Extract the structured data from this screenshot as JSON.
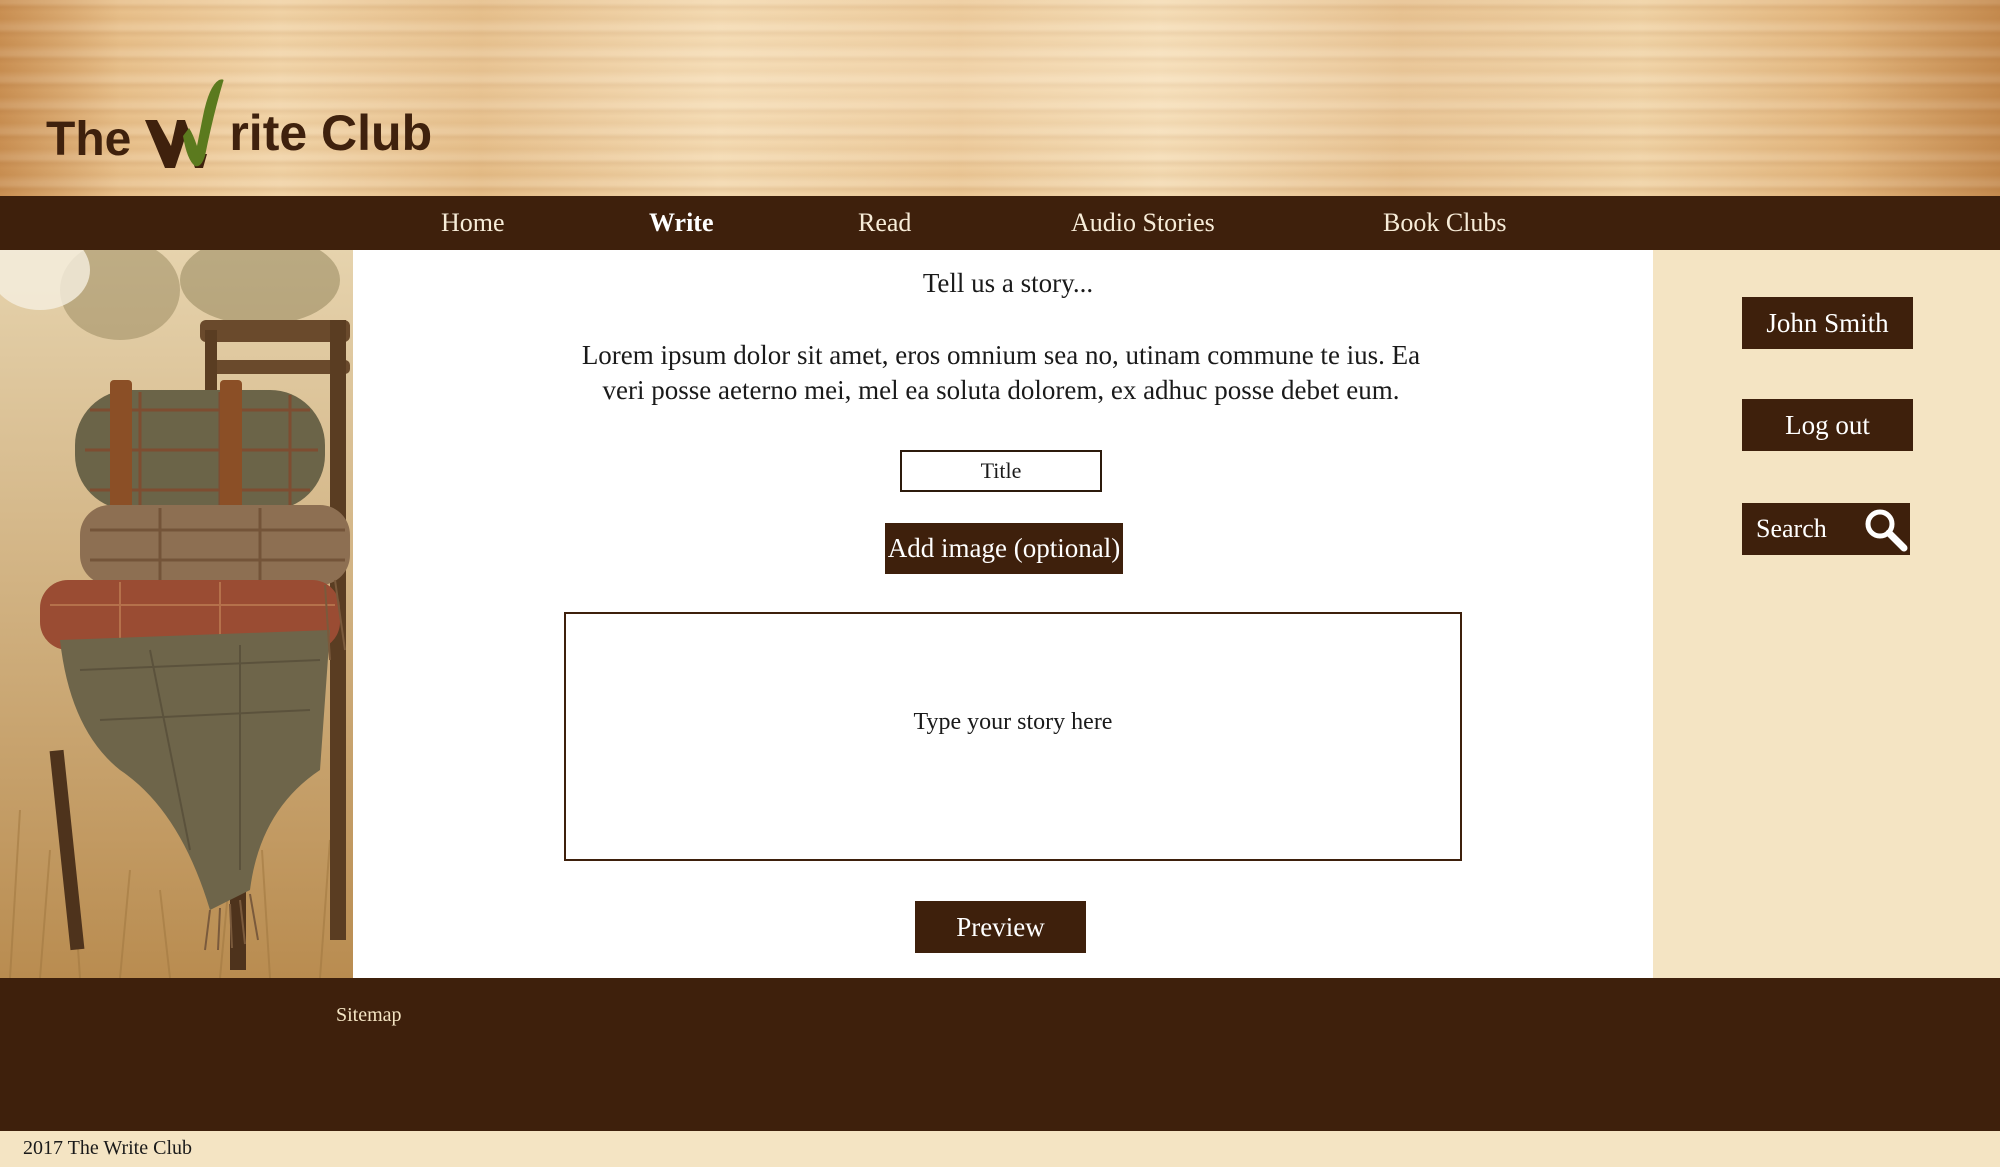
{
  "brand": {
    "logo_prefix": "The",
    "logo_suffix": "rite Club",
    "logo_text": "The Write Club",
    "logo_color": "#3f210d",
    "check_color": "#5b7a1e"
  },
  "nav": {
    "items": [
      {
        "label": "Home",
        "active": false
      },
      {
        "label": "Write",
        "active": true
      },
      {
        "label": "Read",
        "active": false
      },
      {
        "label": "Audio Stories",
        "active": false
      },
      {
        "label": "Book Clubs",
        "active": false
      }
    ]
  },
  "main": {
    "heading": "Tell us a story...",
    "intro": "Lorem ipsum dolor sit amet, eros omnium sea no, utinam commune te ius. Ea veri posse aeterno mei, mel ea soluta dolorem, ex adhuc posse debet eum.",
    "title_placeholder": "Title",
    "add_image_label": "Add image (optional)",
    "story_placeholder": "Type your story here",
    "preview_label": "Preview"
  },
  "sidebar": {
    "user_label": "John Smith",
    "logout_label": "Log out",
    "search_placeholder": "Search",
    "search_icon": "magnifier-icon"
  },
  "footer": {
    "sitemap_label": "Sitemap",
    "copyright": "2017 The Write Club"
  },
  "colors": {
    "primary_dark": "#3e200c",
    "sidebar_bg": "#f4e4c3",
    "content_bg": "#ffffff"
  }
}
